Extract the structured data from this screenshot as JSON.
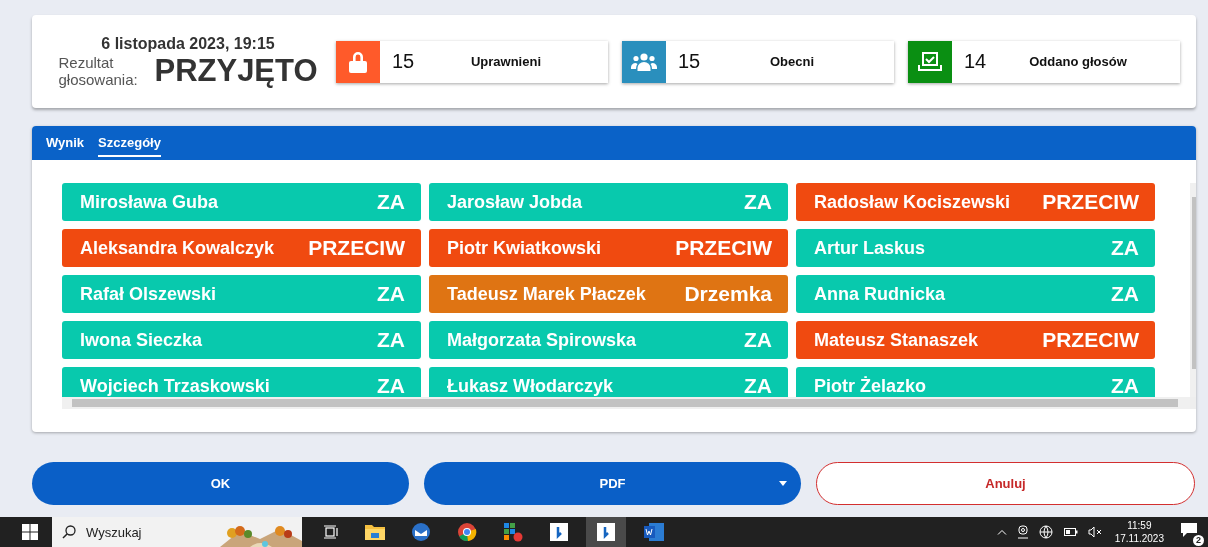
{
  "header": {
    "date": "6 listopada 2023, 19:15",
    "result_label": "Rezultat głosowania:",
    "result": "PRZYJĘTO",
    "stats": [
      {
        "kind": "lock",
        "count": "15",
        "caption": "Uprawnieni",
        "color": "#ff5a2a"
      },
      {
        "kind": "people",
        "count": "15",
        "caption": "Obecni",
        "color": "#2a8fbd"
      },
      {
        "kind": "ballot",
        "count": "14",
        "caption": "Oddano głosów",
        "color": "#0a8f12"
      }
    ]
  },
  "tabs": [
    {
      "label": "Wynik",
      "selected": false
    },
    {
      "label": "Szczegóły",
      "selected": true
    }
  ],
  "votes": [
    {
      "name": "Mirosława Guba",
      "vote": "ZA",
      "color": "#08c9ad"
    },
    {
      "name": "Jarosław Jobda",
      "vote": "ZA",
      "color": "#08c9ad"
    },
    {
      "name": "Radosław Kociszewski",
      "vote": "PRZECIW",
      "color": "#f04a10"
    },
    {
      "name": "Aleksandra Kowalczyk",
      "vote": "PRZECIW",
      "color": "#f04a10"
    },
    {
      "name": "Piotr Kwiatkowski",
      "vote": "PRZECIW",
      "color": "#f04a10"
    },
    {
      "name": "Artur Laskus",
      "vote": "ZA",
      "color": "#08c9ad"
    },
    {
      "name": "Rafał Olszewski",
      "vote": "ZA",
      "color": "#08c9ad"
    },
    {
      "name": "Tadeusz Marek Płaczek",
      "vote": "Drzemka",
      "color": "#df7413"
    },
    {
      "name": "Anna Rudnicka",
      "vote": "ZA",
      "color": "#08c9ad"
    },
    {
      "name": "Iwona Sieczka",
      "vote": "ZA",
      "color": "#08c9ad"
    },
    {
      "name": "Małgorzata Spirowska",
      "vote": "ZA",
      "color": "#08c9ad"
    },
    {
      "name": "Mateusz Stanaszek",
      "vote": "PRZECIW",
      "color": "#f04a10"
    },
    {
      "name": "Wojciech Trzaskowski",
      "vote": "ZA",
      "color": "#08c9ad"
    },
    {
      "name": "Łukasz Włodarczyk",
      "vote": "ZA",
      "color": "#08c9ad"
    },
    {
      "name": "Piotr Żelazko",
      "vote": "ZA",
      "color": "#08c9ad"
    }
  ],
  "buttons": [
    {
      "kind": "primary",
      "label": "OK"
    },
    {
      "kind": "dropdown",
      "label": "PDF"
    },
    {
      "kind": "cancel",
      "label": "Anuluj"
    }
  ],
  "taskbar": {
    "search_placeholder": "Wyszukaj",
    "time": "11:59",
    "date": "17.11.2023",
    "notifications": "2"
  }
}
